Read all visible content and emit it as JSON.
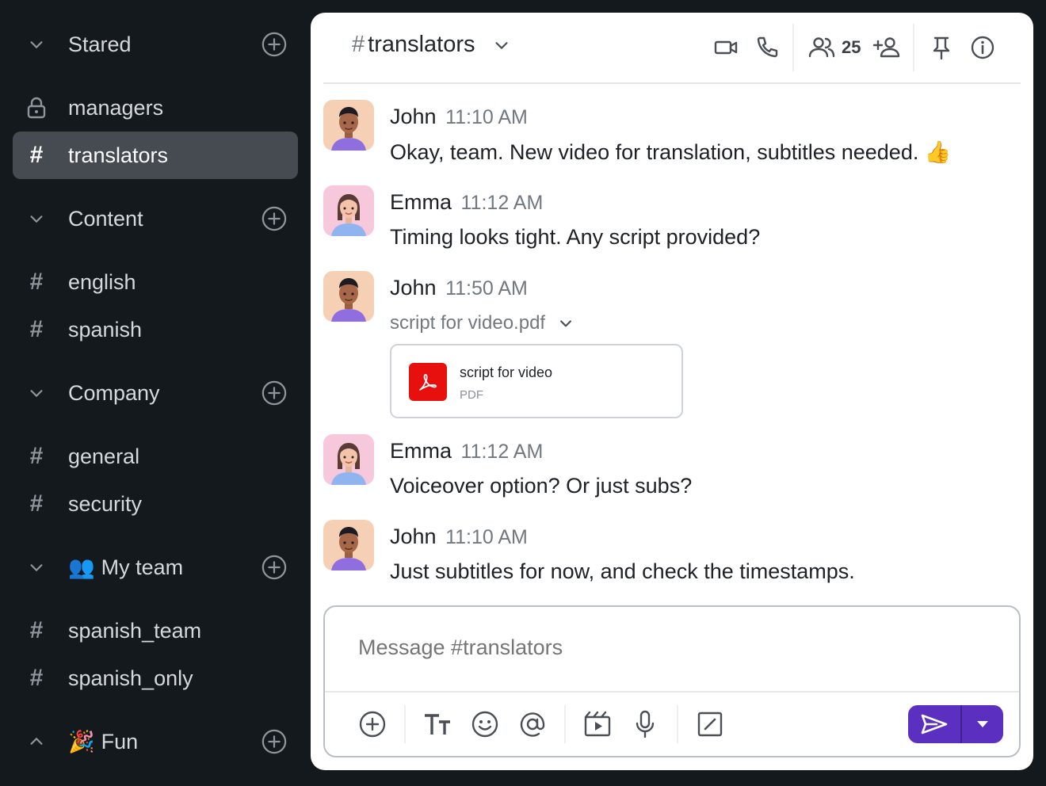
{
  "sidebar": {
    "sections": [
      {
        "label": "Stared"
      },
      {
        "label": "Content"
      },
      {
        "label": "Company"
      },
      {
        "label": "My team",
        "emoji": "👥"
      },
      {
        "label": "Fun",
        "emoji": "🎉"
      }
    ],
    "channels": {
      "managers": "managers",
      "translators": "translators",
      "english": "english",
      "spanish": "spanish",
      "general": "general",
      "security": "security",
      "spanish_team": "spanish_team",
      "spanish_only": "spanish_only"
    },
    "hash": "#"
  },
  "header": {
    "hash": "#",
    "channel_name": "translators",
    "member_count": "25"
  },
  "messages": [
    {
      "author": "John",
      "time": "11:10 AM",
      "text": "Okay, team. New video for translation, subtitles needed.",
      "emoji": "👍"
    },
    {
      "author": "Emma",
      "time": "11:12 AM",
      "text": "Timing looks tight. Any script provided?"
    },
    {
      "author": "John",
      "time": "11:50 AM",
      "file_line": "script for video.pdf",
      "file": {
        "name": "script for video",
        "type": "PDF"
      }
    },
    {
      "author": "Emma",
      "time": "11:12 AM",
      "text": "Voiceover option? Or just subs?"
    },
    {
      "author": "John",
      "time": "11:10 AM",
      "text": "Just subtitles for now, and check the timestamps."
    }
  ],
  "composer": {
    "placeholder": "Message #translators"
  },
  "colors": {
    "sidebar_bg": "#14191d",
    "active_item": "#464b51",
    "send_button": "#5b2fbf",
    "pdf_red": "#e8100f"
  }
}
